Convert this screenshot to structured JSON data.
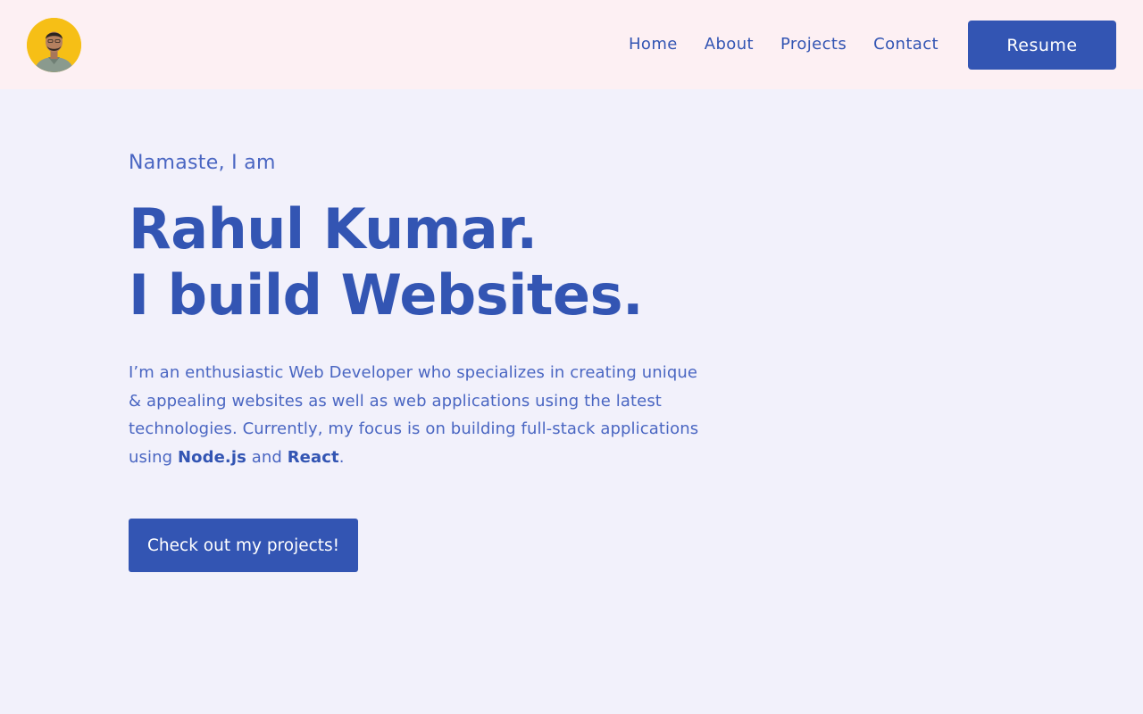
{
  "header": {
    "avatar_icon": "profile-photo",
    "nav": [
      {
        "label": "Home"
      },
      {
        "label": "About"
      },
      {
        "label": "Projects"
      },
      {
        "label": "Contact"
      }
    ],
    "resume_label": "Resume"
  },
  "hero": {
    "greeting": "Namaste, I am",
    "name_line": "Rahul Kumar.",
    "tagline": "I build Websites.",
    "bio": {
      "part1": "I’m an enthusiastic Web Developer who specializes in creating unique & appealing websites as well as web applications using the latest technologies. Currently, my focus is on building full-stack applications using ",
      "tech1": "Node.js",
      "part2": " and ",
      "tech2": "React",
      "part3": "."
    },
    "cta_label": "Check out my projects!"
  },
  "colors": {
    "primary": "#3355b3",
    "text": "#4a66c2",
    "background": "#f2f1fb",
    "header_background": "#fdf0f3",
    "avatar_background": "#f6bf16"
  }
}
